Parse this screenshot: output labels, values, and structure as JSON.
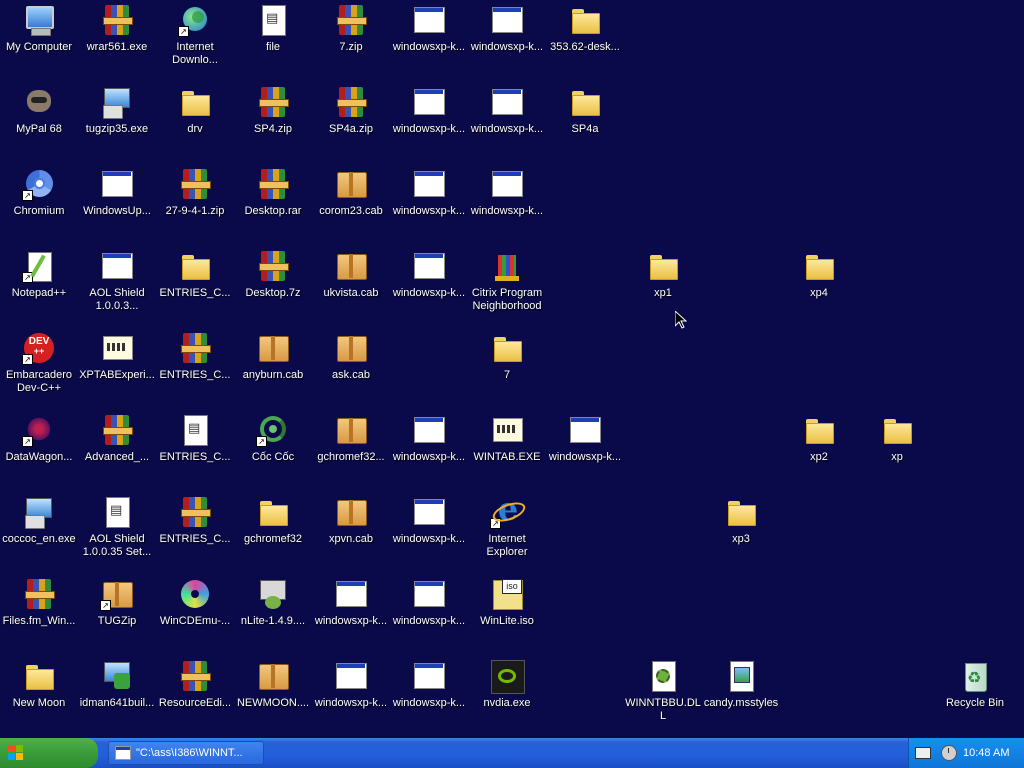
{
  "desktop": {
    "icons": [
      {
        "label": "My Computer",
        "icon": "computer-icon",
        "glyph": "computer",
        "shortcut": false
      },
      {
        "label": "wrar561.exe",
        "icon": "winrar-icon",
        "glyph": "rar",
        "shortcut": false
      },
      {
        "label": "Internet Downlo...",
        "icon": "internet-download-manager-icon",
        "glyph": "globe",
        "shortcut": true
      },
      {
        "label": "file",
        "icon": "file-icon",
        "glyph": "file",
        "shortcut": false
      },
      {
        "label": "7.zip",
        "icon": "zip-archive-icon",
        "glyph": "rar",
        "shortcut": false
      },
      {
        "label": "windowsxp-k...",
        "icon": "application-window-icon",
        "glyph": "window",
        "shortcut": false
      },
      {
        "label": "windowsxp-k...",
        "icon": "application-window-icon",
        "glyph": "window",
        "shortcut": false
      },
      {
        "label": "353.62-desk...",
        "icon": "folder-icon",
        "glyph": "folder",
        "shortcut": false
      },
      {
        "label": "MyPal 68",
        "icon": "mypal-browser-icon",
        "glyph": "animal",
        "shortcut": false
      },
      {
        "label": "tugzip35.exe",
        "icon": "setup-icon",
        "glyph": "setup",
        "shortcut": false
      },
      {
        "label": "drv",
        "icon": "folder-icon",
        "glyph": "folder",
        "shortcut": false
      },
      {
        "label": "SP4.zip",
        "icon": "zip-archive-icon",
        "glyph": "rar",
        "shortcut": false
      },
      {
        "label": "SP4a.zip",
        "icon": "zip-archive-icon",
        "glyph": "rar",
        "shortcut": false
      },
      {
        "label": "windowsxp-k...",
        "icon": "application-window-icon",
        "glyph": "window",
        "shortcut": false
      },
      {
        "label": "windowsxp-k...",
        "icon": "application-window-icon",
        "glyph": "window",
        "shortcut": false
      },
      {
        "label": "SP4a",
        "icon": "folder-icon",
        "glyph": "folder",
        "shortcut": false
      },
      {
        "label": "Chromium",
        "icon": "chromium-icon",
        "glyph": "chromium",
        "shortcut": true
      },
      {
        "label": "WindowsUp...",
        "icon": "application-window-icon",
        "glyph": "window",
        "shortcut": false
      },
      {
        "label": "27-9-4-1.zip",
        "icon": "zip-archive-icon",
        "glyph": "rar",
        "shortcut": false
      },
      {
        "label": "Desktop.rar",
        "icon": "rar-archive-icon",
        "glyph": "rar",
        "shortcut": false
      },
      {
        "label": "corom23.cab",
        "icon": "cab-archive-icon",
        "glyph": "cab",
        "shortcut": false
      },
      {
        "label": "windowsxp-k...",
        "icon": "application-window-icon",
        "glyph": "window",
        "shortcut": false
      },
      {
        "label": "windowsxp-k...",
        "icon": "application-window-icon",
        "glyph": "window",
        "shortcut": false
      },
      {
        "label": "Notepad++",
        "icon": "notepad-plus-plus-icon",
        "glyph": "notepad",
        "shortcut": true
      },
      {
        "label": "AOL Shield 1.0.0.3...",
        "icon": "application-window-icon",
        "glyph": "window",
        "shortcut": false
      },
      {
        "label": "ENTRIES_C...",
        "icon": "folder-icon",
        "glyph": "folder",
        "shortcut": false
      },
      {
        "label": "Desktop.7z",
        "icon": "7z-archive-icon",
        "glyph": "rar",
        "shortcut": false
      },
      {
        "label": "ukvista.cab",
        "icon": "cab-archive-icon",
        "glyph": "cab",
        "shortcut": false
      },
      {
        "label": "windowsxp-k...",
        "icon": "application-window-icon",
        "glyph": "window",
        "shortcut": false
      },
      {
        "label": "Citrix Program Neighborhood",
        "icon": "citrix-icon",
        "glyph": "citrix",
        "shortcut": false
      },
      {
        "label": "xp1",
        "icon": "folder-icon",
        "glyph": "folder",
        "shortcut": false
      },
      {
        "label": "xp4",
        "icon": "folder-icon",
        "glyph": "folder",
        "shortcut": false
      },
      {
        "label": "Embarcadero Dev-C++",
        "icon": "dev-cpp-icon",
        "glyph": "dev",
        "shortcut": true
      },
      {
        "label": "XPTABExperi...",
        "icon": "xptab-icon",
        "glyph": "xptab",
        "shortcut": false
      },
      {
        "label": "ENTRIES_C...",
        "icon": "rar-archive-icon",
        "glyph": "rar",
        "shortcut": false
      },
      {
        "label": "anyburn.cab",
        "icon": "cab-archive-icon",
        "glyph": "cab",
        "shortcut": false
      },
      {
        "label": "ask.cab",
        "icon": "cab-archive-icon",
        "glyph": "cab",
        "shortcut": false
      },
      {
        "label": "7",
        "icon": "folder-icon",
        "glyph": "folder",
        "shortcut": false
      },
      {
        "label": "DataWagon...",
        "icon": "datawagon-icon",
        "glyph": "datawagon",
        "shortcut": true
      },
      {
        "label": "Advanced_...",
        "icon": "rar-archive-icon",
        "glyph": "rar",
        "shortcut": false
      },
      {
        "label": "ENTRIES_C...",
        "icon": "text-file-icon",
        "glyph": "file",
        "shortcut": false
      },
      {
        "label": "Cốc Cốc",
        "icon": "coccoc-browser-icon",
        "glyph": "coccoc",
        "shortcut": true
      },
      {
        "label": "gchromef32...",
        "icon": "cab-archive-icon",
        "glyph": "cab",
        "shortcut": false
      },
      {
        "label": "windowsxp-k...",
        "icon": "application-window-icon",
        "glyph": "window",
        "shortcut": false
      },
      {
        "label": "WINTAB.EXE",
        "icon": "xptab-icon",
        "glyph": "xptab",
        "shortcut": false
      },
      {
        "label": "windowsxp-k...",
        "icon": "application-window-icon",
        "glyph": "window",
        "shortcut": false
      },
      {
        "label": "xp2",
        "icon": "folder-icon",
        "glyph": "folder",
        "shortcut": false
      },
      {
        "label": "xp",
        "icon": "folder-icon",
        "glyph": "folder",
        "shortcut": false
      },
      {
        "label": "coccoc_en.exe",
        "icon": "setup-icon",
        "glyph": "setup",
        "shortcut": false
      },
      {
        "label": "AOL Shield 1.0.0.35 Set...",
        "icon": "text-file-icon",
        "glyph": "file",
        "shortcut": false
      },
      {
        "label": "ENTRIES_C...",
        "icon": "rar-archive-icon",
        "glyph": "rar",
        "shortcut": false
      },
      {
        "label": "gchromef32",
        "icon": "folder-icon",
        "glyph": "folder",
        "shortcut": false
      },
      {
        "label": "xpvn.cab",
        "icon": "cab-archive-icon",
        "glyph": "cab",
        "shortcut": false
      },
      {
        "label": "windowsxp-k...",
        "icon": "application-window-icon",
        "glyph": "window",
        "shortcut": false
      },
      {
        "label": "Internet Explorer",
        "icon": "internet-explorer-icon",
        "glyph": "ie",
        "shortcut": true
      },
      {
        "label": "xp3",
        "icon": "folder-icon",
        "glyph": "folder",
        "shortcut": false
      },
      {
        "label": "Files.fm_Win...",
        "icon": "rar-archive-icon",
        "glyph": "rar",
        "shortcut": false
      },
      {
        "label": "TUGZip",
        "icon": "cab-archive-icon",
        "glyph": "cab",
        "shortcut": true
      },
      {
        "label": "WinCDEmu-...",
        "icon": "cd-icon",
        "glyph": "cd",
        "shortcut": false
      },
      {
        "label": "nLite-1.4.9....",
        "icon": "nlite-icon",
        "glyph": "nlite",
        "shortcut": false
      },
      {
        "label": "windowsxp-k...",
        "icon": "application-window-icon",
        "glyph": "window",
        "shortcut": false
      },
      {
        "label": "windowsxp-k...",
        "icon": "application-window-icon",
        "glyph": "window",
        "shortcut": false
      },
      {
        "label": "WinLite.iso",
        "icon": "iso-file-icon",
        "glyph": "iso",
        "shortcut": false
      },
      {
        "label": "New Moon",
        "icon": "folder-icon",
        "glyph": "folder",
        "shortcut": false
      },
      {
        "label": "idman641buil...",
        "icon": "idm-setup-icon",
        "glyph": "idman",
        "shortcut": false
      },
      {
        "label": "ResourceEdi...",
        "icon": "rar-archive-icon",
        "glyph": "rar",
        "shortcut": false
      },
      {
        "label": "NEWMOON....",
        "icon": "cab-archive-icon",
        "glyph": "cab",
        "shortcut": false
      },
      {
        "label": "windowsxp-k...",
        "icon": "application-window-icon",
        "glyph": "window",
        "shortcut": false
      },
      {
        "label": "windowsxp-k...",
        "icon": "application-window-icon",
        "glyph": "window",
        "shortcut": false
      },
      {
        "label": "nvdia.exe",
        "icon": "nvidia-icon",
        "glyph": "nvidia",
        "shortcut": false
      },
      {
        "label": "WINNTBBU.DLL",
        "icon": "dll-file-icon",
        "glyph": "dll",
        "shortcut": false
      },
      {
        "label": "candy.msstyles",
        "icon": "msstyles-file-icon",
        "glyph": "theme",
        "shortcut": false
      },
      {
        "label": "Recycle Bin",
        "icon": "recycle-bin-icon",
        "glyph": "recycle",
        "shortcut": false
      }
    ]
  },
  "taskbar": {
    "task_label": "\"C:\\ass\\I386\\WINNT...",
    "clock": "10:48 AM",
    "colors": {
      "start": "#3a9b3a",
      "bar": "#245edb",
      "tray": "#0f74d8"
    }
  }
}
